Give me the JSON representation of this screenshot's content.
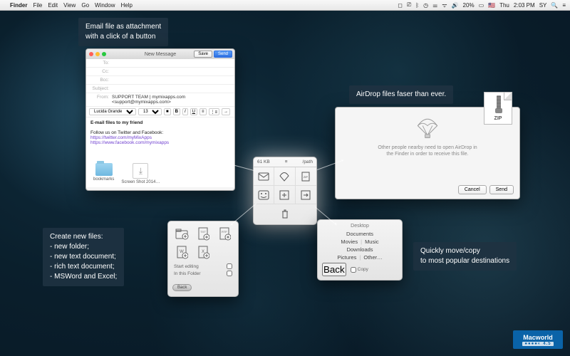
{
  "menubar": {
    "app": "Finder",
    "items": [
      "File",
      "Edit",
      "View",
      "Go",
      "Window",
      "Help"
    ],
    "battery": "20%",
    "flag": "🇺🇸",
    "day": "Thu",
    "time": "2:03 PM",
    "user": "SY"
  },
  "callouts": {
    "email": "Email file as attachment\nwith a click of a button",
    "airdrop": "AirDrop files faser than ever.",
    "newfiles": "Create new files:\n- new folder;\n- new text document;\n- rich text document;\n- MSWord and Excel;",
    "move": "Quickly move/copy\nto most popular destinations"
  },
  "mail": {
    "title": "New Message",
    "save": "Save",
    "send": "Send",
    "to_lbl": "To:",
    "cc_lbl": "Cc:",
    "bcc_lbl": "Bcc:",
    "subject_lbl": "Subject:",
    "from_lbl": "From:",
    "from_val": "SUPPORT TEAM | mymixapps.com <support@mymixapps.com>",
    "font": "Lucida Grande",
    "size": "13",
    "body_title": "E-mail files to my friend",
    "body_follow": "Follow us on Twitter and Facebook:",
    "link1": "https://twitter.com/myMixApps",
    "link2": "https://www.facebook.com/mymixapps",
    "att1": "bookmarks",
    "att2": "Screen Shot 2014…"
  },
  "airdrop": {
    "msg": "Other people nearby need to open AirDrop in\nthe Finder in order to receive this file.",
    "cancel": "Cancel",
    "send": "Send",
    "zip": "ZIP"
  },
  "hub": {
    "size": "61 KB",
    "path": "/path"
  },
  "newpanel": {
    "start_editing": "Start editing",
    "in_this_folder": "In this Folder",
    "back": "Back"
  },
  "dest": {
    "title": "Desktop",
    "documents": "Documents",
    "movies": "Movies",
    "music": "Music",
    "downloads": "Downloads",
    "pictures": "Pictures",
    "other": "Other…",
    "back": "Back",
    "copy": "Copy"
  },
  "badge": {
    "name": "Macworld",
    "rating": "4.5"
  }
}
